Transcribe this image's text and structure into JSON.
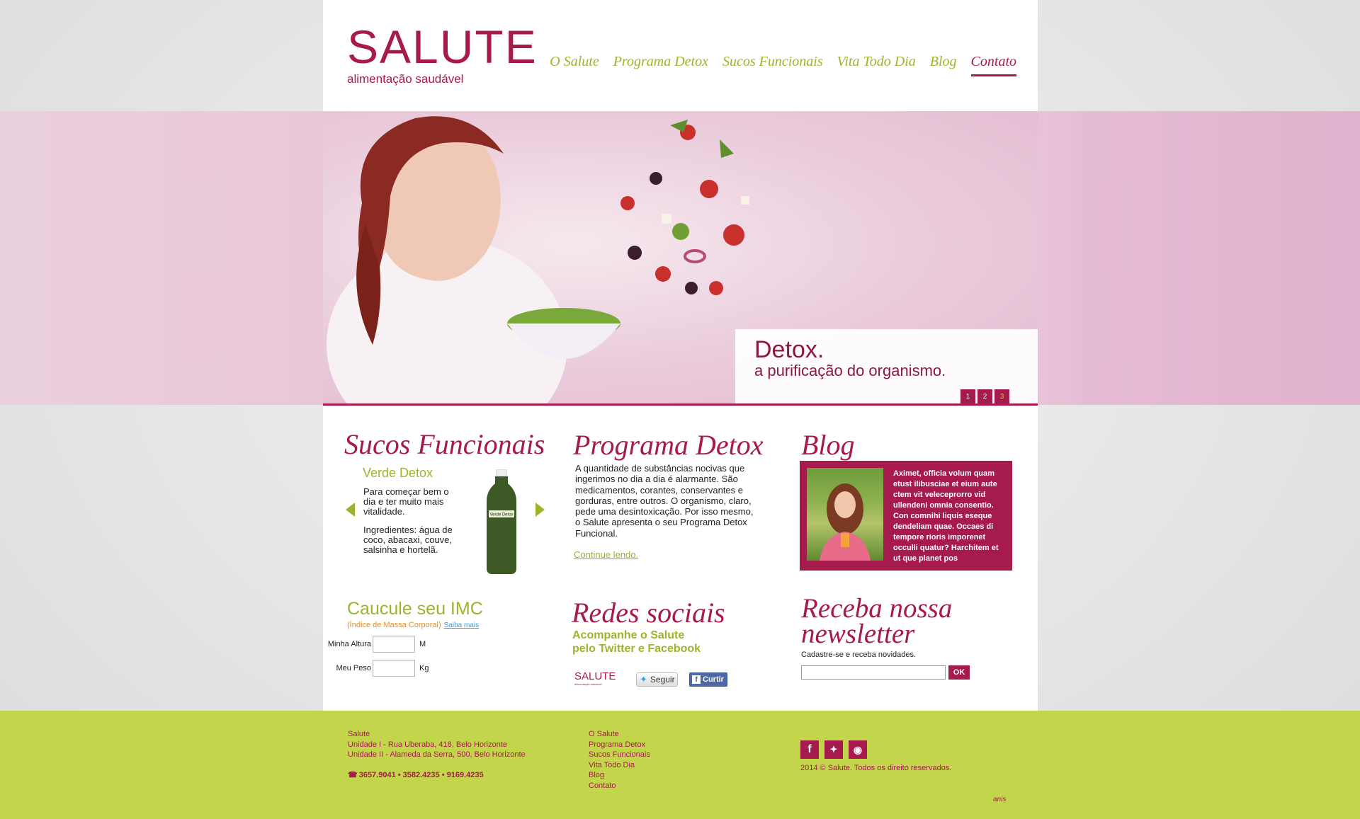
{
  "brand": {
    "logo_word": "SALUTE",
    "tagline": "alimentação saudável",
    "accent_color": "#a61a4e",
    "green_color": "#9bb52b"
  },
  "nav": {
    "items": [
      "O Salute",
      "Programa Detox",
      "Sucos Funcionais",
      "Vita Todo Dia",
      "Blog",
      "Contato"
    ],
    "active": "Contato"
  },
  "hero": {
    "title": "Detox.",
    "subtitle": "a purificação do organismo.",
    "slides": [
      "1",
      "2",
      "3"
    ]
  },
  "sucos": {
    "title": "Sucos Funcionais",
    "product_name": "Verde Detox",
    "description": "Para começar bem o dia e ter muito mais vitalidade.",
    "ingredients": "Ingredientes: água de coco, abacaxi, couve, salsinha e hortelã.",
    "bottle_label": "Verde Detox"
  },
  "detox": {
    "title": "Programa Detox",
    "text": "A quantidade de substâncias nocivas que ingerimos no dia a dia é alarmante. São medicamentos, corantes, conservantes e gorduras, entre outros. O organismo, claro, pede uma desintoxicação. Por isso mesmo, o Salute apresenta o seu Programa Detox Funcional.",
    "link": "Continue lendo."
  },
  "blog": {
    "title": "Blog",
    "text": "Aximet, officia volum quam etust ilibusciae et eium aute ctem vit veleceprorro vid ullendeni omnia consentio. Con comnihi liquis eseque dendeliam quae. Occaes di tempore rioris imporenet occulli quatur? Harchitem et ut que planet pos"
  },
  "imc": {
    "title": "Caucule seu IMC",
    "subtitle": "(Índice de Massa Corporal)",
    "more_link": "Saiba mais",
    "height_label": "Minha Altura",
    "height_unit": "M",
    "weight_label": "Meu Peso",
    "weight_unit": "Kg"
  },
  "redes": {
    "title": "Redes sociais",
    "subtitle_line1": "Acompanhe o Salute",
    "subtitle_line2": "pelo Twitter e Facebook",
    "mini_logo": "SALUTE",
    "mini_tagline": "alimentação saudável",
    "follow_label": "Seguir",
    "like_label": "Curtir"
  },
  "newsletter": {
    "title": "Receba nossa newsletter",
    "subtitle": "Cadastre-se e receba novidades.",
    "button": "OK"
  },
  "footer": {
    "address_lines": [
      "Salute",
      "Unidade I - Rua Uberaba, 418, Belo Horizonte",
      "Unidade II - Alameda da Serra, 500, Belo Horizonte"
    ],
    "phones": "3657.9041 • 3582.4235 • 9169.4235",
    "links": [
      "O Salute",
      "Programa Detox",
      "Sucos Funcionais",
      "Vita Todo Dia",
      "Blog",
      "Contato"
    ],
    "copyright": "2014 © Salute. Todos os direito reservados.",
    "credit": "anis"
  }
}
